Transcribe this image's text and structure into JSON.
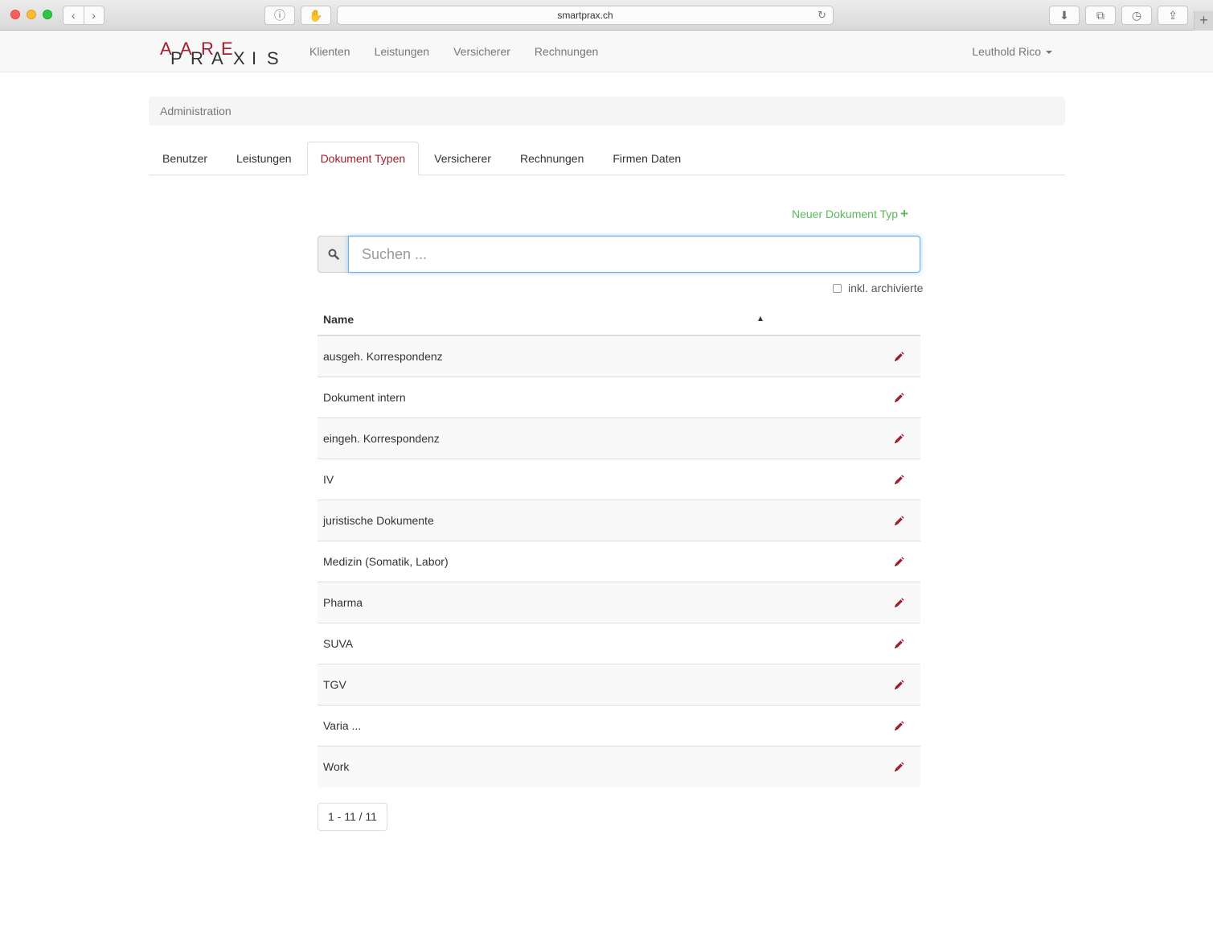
{
  "browser": {
    "url": "smartprax.ch"
  },
  "navbar": {
    "links": [
      "Klienten",
      "Leistungen",
      "Versicherer",
      "Rechnungen"
    ],
    "user": "Leuthold Rico"
  },
  "breadcrumb": "Administration",
  "tabs": [
    "Benutzer",
    "Leistungen",
    "Dokument Typen",
    "Versicherer",
    "Rechnungen",
    "Firmen Daten"
  ],
  "active_tab": "Dokument Typen",
  "new_button": "Neuer Dokument Typ",
  "search": {
    "placeholder": "Suchen ..."
  },
  "archived_label": "inkl. archivierte",
  "table": {
    "header": "Name",
    "rows": [
      "ausgeh. Korrespondenz",
      "Dokument intern",
      "eingeh. Korrespondenz",
      "IV",
      "juristische Dokumente",
      "Medizin (Somatik, Labor)",
      "Pharma",
      "SUVA",
      "TGV",
      "Varia ...",
      "Work"
    ]
  },
  "pagination": "1 - 11 / 11",
  "colors": {
    "brand": "#a11d2e",
    "success": "#5cb85c"
  }
}
